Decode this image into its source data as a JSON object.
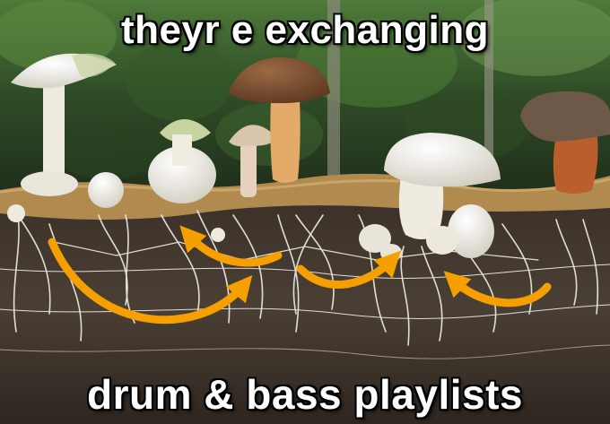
{
  "meme": {
    "top_text": "theyr e exchanging",
    "bottom_text": "drum & bass playlists"
  },
  "colors": {
    "arrow": "#f5a000",
    "soil": "#3a3027",
    "moss": "#b08a4e",
    "foliage": "#3f6b2a",
    "mycelium": "#f2f0ea"
  },
  "icons": [
    "arrow-icon"
  ]
}
